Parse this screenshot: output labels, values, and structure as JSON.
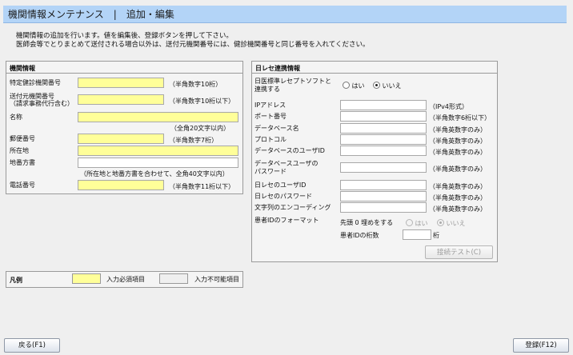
{
  "header": {
    "title": "機関情報メンテナンス",
    "separator": "|",
    "subtitle": "追加・編集"
  },
  "description": {
    "line1": "機関情報の追加を行います。値を編集後、登録ボタンを押して下さい。",
    "line2": "医師会等でとりまとめて送付される場合以外は、送付元機関番号には、健診機関番号と同じ番号を入れてください。"
  },
  "institution": {
    "title": "機関情報",
    "checkup_no": {
      "label": "特定健診機関番号",
      "value": "",
      "hint": "（半角数字10桁）"
    },
    "sender_no": {
      "label_line1": "送付元機関番号",
      "label_line2": "（請求事務代行含む）",
      "value": "",
      "hint": "（半角数字10桁以下）"
    },
    "name": {
      "label": "名称",
      "value": "",
      "hint": "（全角20文字以内）"
    },
    "postal": {
      "label": "郵便番号",
      "value": "",
      "hint": "（半角数字7桁）"
    },
    "address": {
      "label": "所在地",
      "value": ""
    },
    "block": {
      "label": "地番方書",
      "value": "",
      "hint": "（所在地と地番方書を合わせて、全角40文字以内）"
    },
    "phone": {
      "label": "電話番号",
      "value": "",
      "hint": "（半角数字11桁以下）"
    }
  },
  "orca": {
    "title": "日レセ連携情報",
    "use_orca": {
      "label_line1": "日医標準レセプトソフトと",
      "label_line2": "連携する",
      "yes": "はい",
      "no": "いいえ",
      "selected": "no"
    },
    "ip": {
      "label": "IPアドレス",
      "value": "",
      "hint": "（IPv4形式）"
    },
    "port": {
      "label": "ポート番号",
      "value": "",
      "hint": "（半角数字6桁以下）"
    },
    "dbname": {
      "label": "データベース名",
      "value": "",
      "hint": "（半角英数字のみ）"
    },
    "protocol": {
      "label": "プロトコル",
      "value": "",
      "hint": "（半角英数字のみ）"
    },
    "dbuser": {
      "label": "データベースのユーザID",
      "value": "",
      "hint": "（半角英数字のみ）"
    },
    "dbpass": {
      "label_line1": "データベースユーザの",
      "label_line2": "パスワード",
      "value": "",
      "hint": "（半角英数字のみ）"
    },
    "orca_user": {
      "label": "日レセのユーザID",
      "value": "",
      "hint": "（半角英数字のみ）"
    },
    "orca_pass": {
      "label": "日レセのパスワード",
      "value": "",
      "hint": "（半角英数字のみ）"
    },
    "encoding": {
      "label": "文字列のエンコーディング",
      "value": "",
      "hint": "（半角英数字のみ）"
    },
    "patient_format": {
      "label": "患者IDのフォーマット",
      "zero_pad_label": "先頭 0 埋めをする",
      "yes": "はい",
      "no": "いいえ",
      "selected": "no",
      "digits_label": "患者IDの桁数",
      "digits_value": "",
      "digits_unit": "桁"
    },
    "test_button": "接続テスト(C)"
  },
  "legend": {
    "title": "凡例",
    "required": "入力必須項目",
    "disabled": "入力不可能項目"
  },
  "footer": {
    "back_button": "戻る(F1)",
    "register_button": "登録(F12)"
  },
  "colors": {
    "required_field": "#ffff99",
    "title_bar": "#b3d4f7"
  }
}
